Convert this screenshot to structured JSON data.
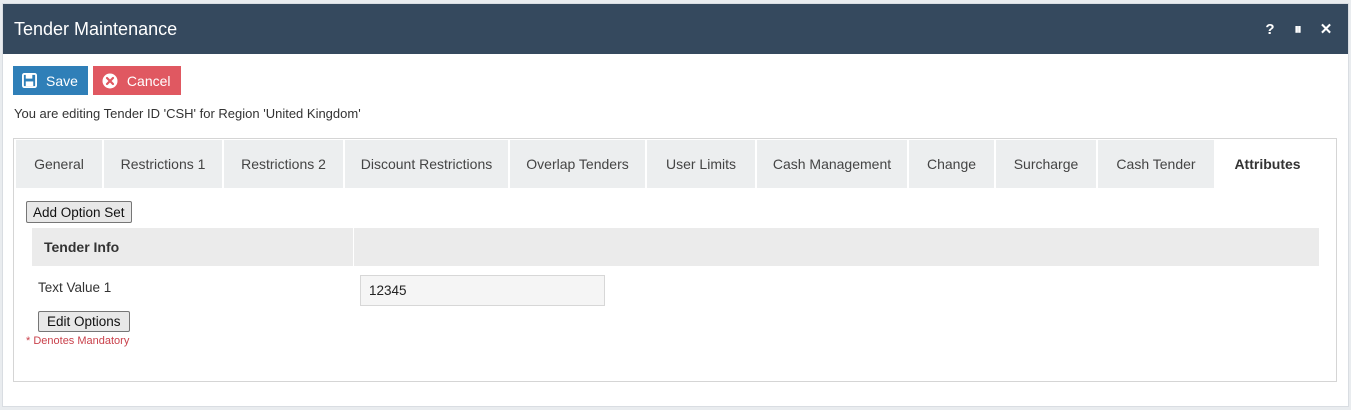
{
  "window": {
    "title": "Tender Maintenance",
    "controls": [
      "?",
      "⏸",
      "✕"
    ]
  },
  "toolbar": {
    "save_label": "Save",
    "cancel_label": "Cancel"
  },
  "editing_message": "You are editing Tender ID 'CSH' for Region 'United Kingdom'",
  "tabs": [
    {
      "label": "General"
    },
    {
      "label": "Restrictions 1"
    },
    {
      "label": "Restrictions 2"
    },
    {
      "label": "Discount Restrictions"
    },
    {
      "label": "Overlap Tenders"
    },
    {
      "label": "User Limits"
    },
    {
      "label": "Cash Management"
    },
    {
      "label": "Change"
    },
    {
      "label": "Surcharge"
    },
    {
      "label": "Cash Tender"
    },
    {
      "label": "Attributes",
      "active": true
    }
  ],
  "attributes": {
    "add_option_set_label": "Add Option Set",
    "section_title": "Tender Info",
    "fields": [
      {
        "label": "Text Value 1",
        "value": "12345"
      }
    ],
    "edit_options_label": "Edit Options",
    "mandatory_note": "* Denotes Mandatory"
  },
  "colors": {
    "titlebar": "#35495e",
    "save": "#2f7fb8",
    "cancel": "#e05861",
    "mandatory": "#c9414b"
  }
}
